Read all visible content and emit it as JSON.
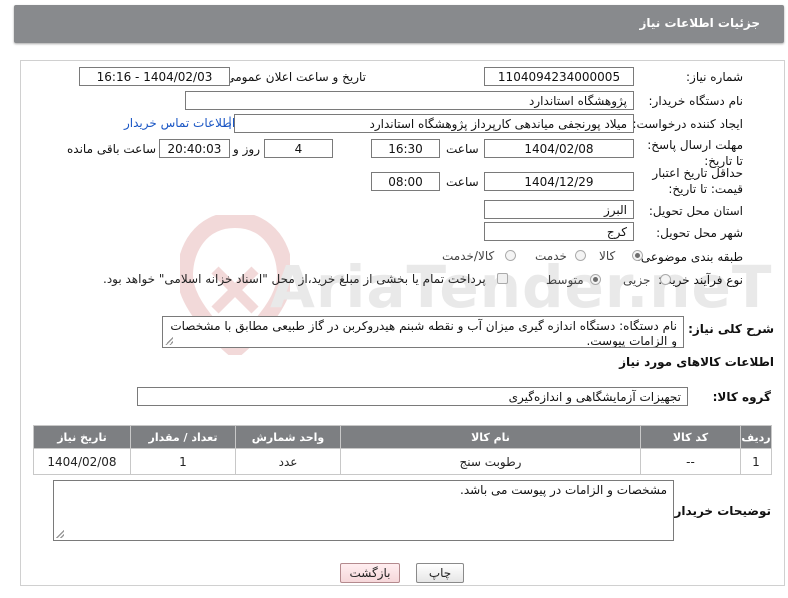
{
  "header": {
    "title": "جزئیات اطلاعات نیاز"
  },
  "form": {
    "need_number_label": "شماره نیاز:",
    "need_number": "1104094234000005",
    "announce_label": "تاریخ و ساعت اعلان عمومی:",
    "announce_value": "1404/02/03 - 16:16",
    "buyer_org_label": "نام دستگاه خریدار:",
    "buyer_org": "پژوهشگاه استاندارد",
    "creator_label": "ایجاد کننده درخواست:",
    "creator": "میلاد پورنجفی میاندهی کارپرداز پژوهشگاه استاندارد",
    "contact_link": "اطلاعات تماس خریدار",
    "deadline_label": "مهلت ارسال پاسخ: تا تاریخ:",
    "deadline_date": "1404/02/08",
    "time_label": "ساعت",
    "deadline_time": "16:30",
    "days_count": "4",
    "days_label": "روز و",
    "remaining_time": "20:40:03",
    "remaining_label": "ساعت باقی مانده",
    "validity_label": "حداقل تاریخ اعتبار قیمت: تا تاریخ:",
    "validity_date": "1404/12/29",
    "validity_time": "08:00",
    "province_label": "استان محل تحویل:",
    "province": "البرز",
    "city_label": "شهر محل تحویل:",
    "city": "کرج",
    "category_label": "طبقه بندی موضوعی:",
    "category_options": [
      "کالا",
      "خدمت",
      "کالا/خدمت"
    ],
    "process_label": "نوع فرآیند خرید :",
    "process_options": [
      "جزیی",
      "متوسط"
    ],
    "payment_note": "پرداخت تمام یا بخشی از مبلغ خرید،از محل \"اسناد خزانه اسلامی\" خواهد بود.",
    "summary_label": "شرح کلی نیاز:",
    "summary_text": "نام دستگاه: دستگاه اندازه گیری میزان آب و نقطه شبنم هیدروکربن در گاز طبیعی مطابق با مشخصات و الزامات پیوست."
  },
  "goods": {
    "section_title": "اطلاعات کالاهای مورد نیاز",
    "group_label": "گروه کالا:",
    "group_value": "تجهیزات آزمایشگاهی و اندازه‌گیری",
    "columns": [
      "ردیف",
      "کد کالا",
      "نام کالا",
      "واحد شمارش",
      "تعداد / مقدار",
      "تاریخ نیاز"
    ],
    "rows": [
      [
        "1",
        "--",
        "رطوبت سنج",
        "عدد",
        "1",
        "1404/02/08"
      ]
    ]
  },
  "notes": {
    "label": "توضیحات خریدار:",
    "text": "مشخصات و الزامات در پیوست می باشد."
  },
  "buttons": {
    "print": "چاپ",
    "back": "بازگشت"
  },
  "watermark": {
    "text": "AriaTender.neT"
  }
}
